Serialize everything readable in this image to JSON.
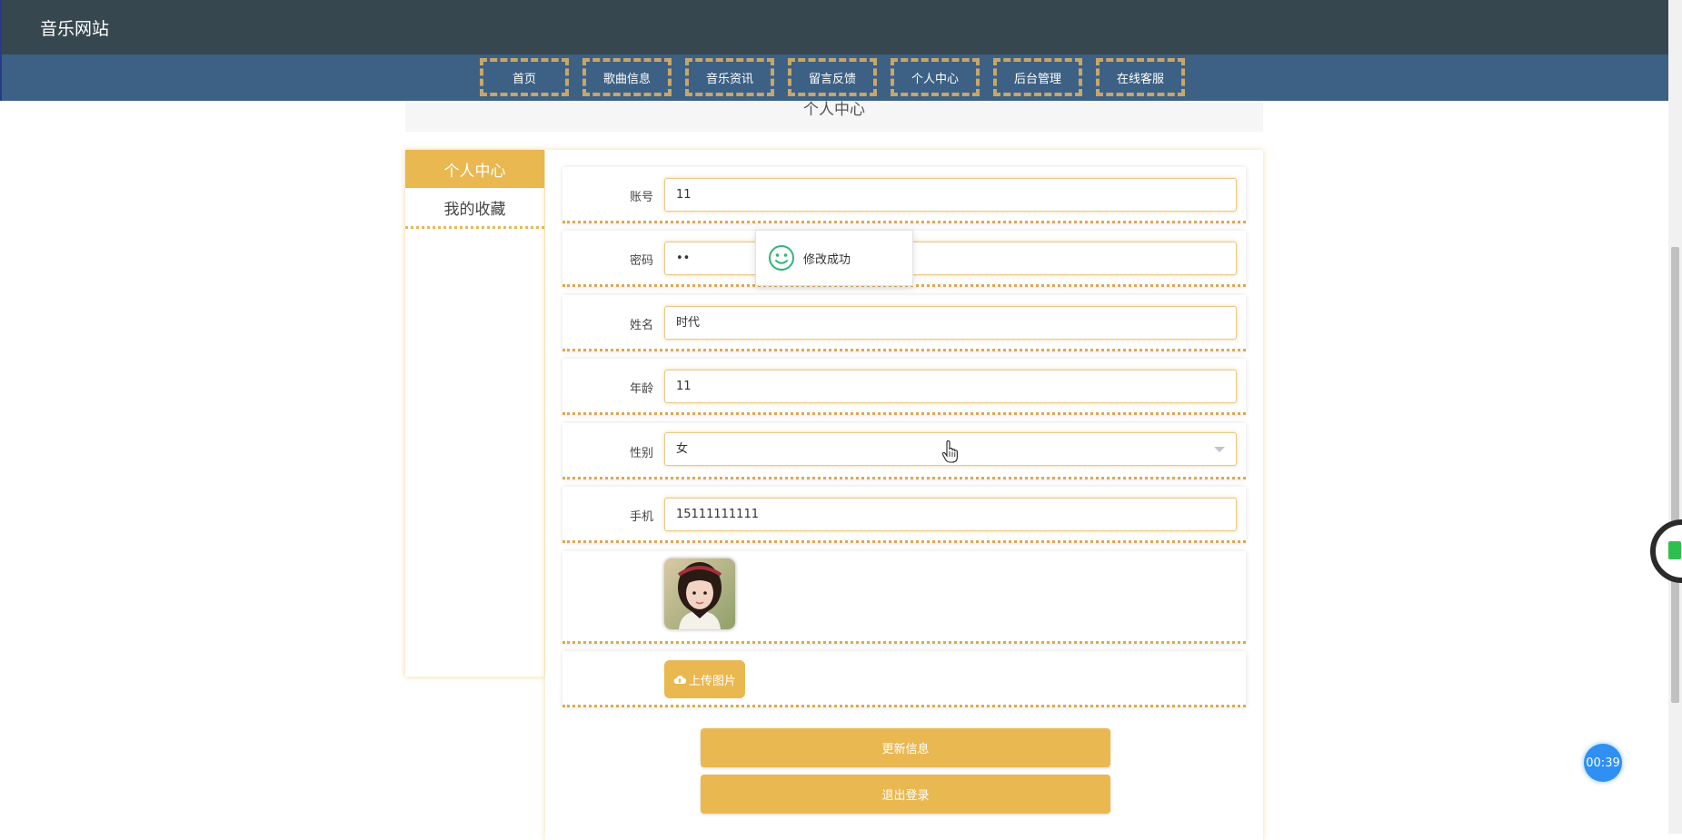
{
  "header": {
    "site_title": "音乐网站"
  },
  "nav": {
    "items": [
      "首页",
      "歌曲信息",
      "音乐资讯",
      "留言反馈",
      "个人中心",
      "后台管理",
      "在线客服"
    ]
  },
  "banner": {
    "title": "个人中心"
  },
  "sidebar": {
    "items": [
      {
        "label": "个人中心",
        "active": true
      },
      {
        "label": "我的收藏",
        "active": false
      }
    ]
  },
  "form": {
    "account_label": "账号",
    "account_value": "11",
    "password_label": "密码",
    "password_value": "••",
    "name_label": "姓名",
    "name_value": "时代",
    "age_label": "年龄",
    "age_value": "11",
    "gender_label": "性别",
    "gender_value": "女",
    "phone_label": "手机",
    "phone_value": "15111111111",
    "upload_label": "上传图片",
    "update_label": "更新信息",
    "logout_label": "退出登录"
  },
  "toast": {
    "message": "修改成功",
    "icon": "smile-icon"
  },
  "timer": {
    "value": "00:39"
  },
  "colors": {
    "accent": "#e9b851",
    "header_bg": "#37474f",
    "nav_bg": "#3d6185",
    "success": "#2fb57b"
  }
}
